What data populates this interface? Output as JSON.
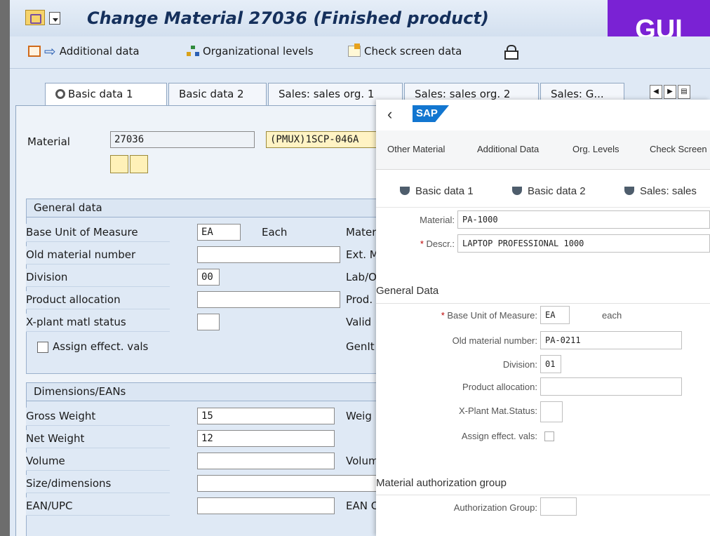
{
  "badge": "GUI",
  "title": "Change Material 27036 (Finished product)",
  "toolbar": {
    "additional_data": "Additional data",
    "org_levels": "Organizational levels",
    "check_screen": "Check screen data"
  },
  "tabs": [
    "Basic data 1",
    "Basic data 2",
    "Sales: sales org. 1",
    "Sales: sales org. 2",
    "Sales: G..."
  ],
  "material": {
    "label": "Material",
    "number": "27036",
    "description": "(PMUX)1SCP-046A"
  },
  "general": {
    "header": "General data",
    "rows": [
      {
        "label": "Base Unit of Measure",
        "value": "EA",
        "extra": "Each",
        "right": "Mater"
      },
      {
        "label": "Old material number",
        "value": "",
        "right": "Ext. M"
      },
      {
        "label": "Division",
        "value": "00",
        "right": "Lab/O"
      },
      {
        "label": "Product allocation",
        "value": "",
        "right": "Prod."
      },
      {
        "label": "X-plant matl status",
        "value": "",
        "right": "Valid"
      },
      {
        "label": "Assign effect. vals",
        "right": "GenIt"
      }
    ]
  },
  "dimensions": {
    "header": "Dimensions/EANs",
    "rows": [
      {
        "label": "Gross Weight",
        "value": "15",
        "right": "Weig"
      },
      {
        "label": "Net Weight",
        "value": "12"
      },
      {
        "label": "Volume",
        "value": "",
        "right": "Volum"
      },
      {
        "label": "Size/dimensions",
        "value": ""
      },
      {
        "label": "EAN/UPC",
        "value": "",
        "right": "EAN C"
      }
    ]
  },
  "fiori": {
    "logo": "SAP",
    "actions": [
      "Other Material",
      "Additional Data",
      "Org. Levels",
      "Check Screen"
    ],
    "tabs": [
      "Basic data 1",
      "Basic data 2",
      "Sales: sales"
    ],
    "material_label": "Material:",
    "material_value": "PA-1000",
    "descr_label": "Descr.:",
    "descr_value": "LAPTOP PROFESSIONAL 1000",
    "general_header": "General Data",
    "base_uom_label": "Base Unit of Measure:",
    "base_uom_value": "EA",
    "base_uom_text": "each",
    "old_mat_label": "Old material number:",
    "old_mat_value": "PA-0211",
    "division_label": "Division:",
    "division_value": "01",
    "prod_alloc_label": "Product allocation:",
    "xplant_label": "X-Plant Mat.Status:",
    "assign_label": "Assign effect. vals:",
    "auth_header": "Material authorization group",
    "auth_label": "Authorization Group:"
  }
}
